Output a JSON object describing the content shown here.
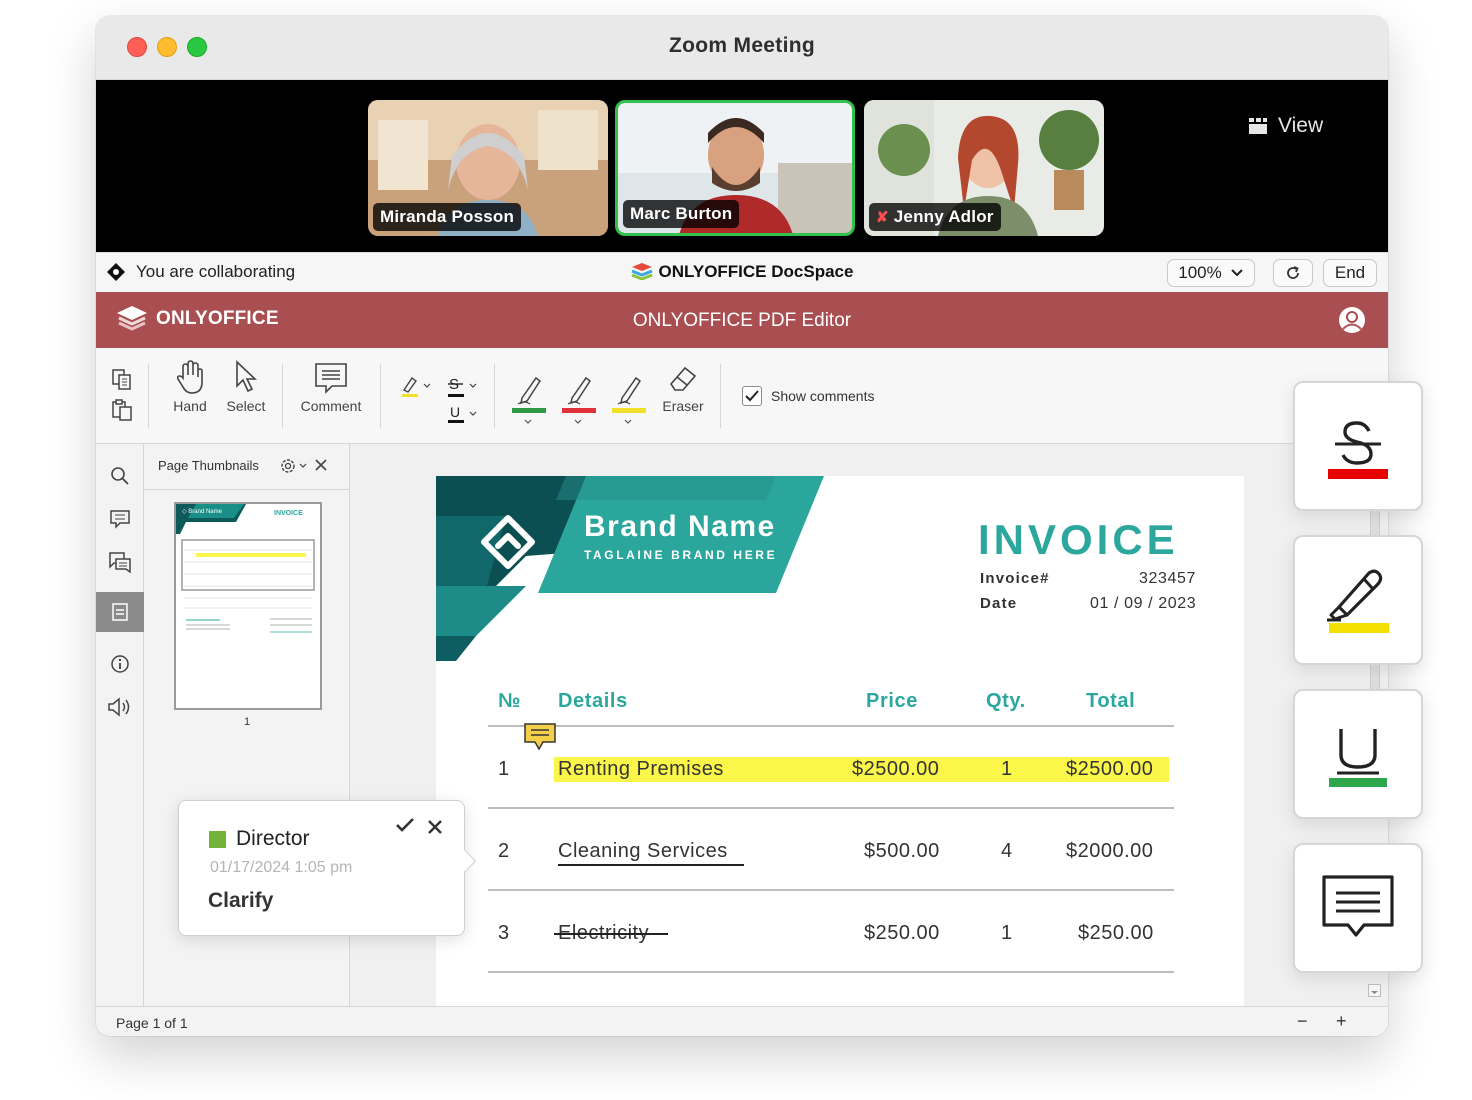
{
  "window": {
    "title": "Zoom Meeting"
  },
  "meeting": {
    "participants": [
      {
        "name": "Miranda Posson",
        "muted": false,
        "active": false
      },
      {
        "name": "Marc Burton",
        "muted": false,
        "active": true
      },
      {
        "name": "Jenny Adlor",
        "muted": true,
        "active": false
      }
    ],
    "view_label": "View"
  },
  "collab_bar": {
    "status": "You are collaborating",
    "app_name": "ONLYOFFICE DocSpace",
    "zoom": "100%",
    "end_label": "End"
  },
  "app_header": {
    "brand": "ONLYOFFICE",
    "title": "ONLYOFFICE PDF Editor",
    "color": "#a94f52"
  },
  "toolbar": {
    "hand": "Hand",
    "select": "Select",
    "comment": "Comment",
    "eraser": "Eraser",
    "show_comments": "Show comments",
    "show_comments_checked": true,
    "pen_colors": [
      "#2e9a45",
      "#e0303a",
      "#f2e12a"
    ]
  },
  "thumbnails": {
    "title": "Page Thumbnails",
    "page_number": "1"
  },
  "status_bar": {
    "page_info": "Page 1 of 1",
    "zoom_out": "−",
    "zoom_in": "+"
  },
  "invoice": {
    "brand_name": "Brand Name",
    "tagline": "TAGLAINE BRAND HERE",
    "heading": "INVOICE",
    "invoice_label": "Invoice#",
    "invoice_number": "323457",
    "date_label": "Date",
    "date": "01 / 09 / 2023",
    "columns": [
      "№",
      "Details",
      "Price",
      "Qty.",
      "Total"
    ],
    "rows": [
      {
        "no": "1",
        "details": "Renting Premises",
        "price": "$2500.00",
        "qty": "1",
        "total": "$2500.00",
        "markup": "highlight"
      },
      {
        "no": "2",
        "details": "Cleaning Services",
        "price": "$500.00",
        "qty": "4",
        "total": "$2000.00",
        "markup": "underline"
      },
      {
        "no": "3",
        "details": "Electricity",
        "price": "$250.00",
        "qty": "1",
        "total": "$250.00",
        "markup": "strikeout"
      }
    ],
    "accent": "#2ba79e",
    "highlight": "#fbf74a"
  },
  "comment": {
    "author": "Director",
    "date": "01/17/2024 1:05 pm",
    "text": "Clarify"
  },
  "annotation_cards": [
    {
      "icon": "strikeout-icon",
      "color": "#e60000"
    },
    {
      "icon": "highlight-pen-icon",
      "color": "#f2e000"
    },
    {
      "icon": "underline-icon",
      "color": "#2ea64b"
    },
    {
      "icon": "comment-icon",
      "color": ""
    }
  ],
  "icons": [
    "copy-icon",
    "paste-icon",
    "hand-icon",
    "cursor-icon",
    "comment-icon",
    "highlighter-icon",
    "strikeout-icon",
    "underline-icon",
    "pen-icon",
    "eraser-icon",
    "search-icon",
    "comments-panel-icon",
    "chat-icon",
    "thumbnails-icon",
    "info-icon",
    "speaker-icon",
    "settings-icon",
    "close-icon",
    "check-icon",
    "user-icon",
    "refresh-icon",
    "chevron-down-icon",
    "view-grid-icon",
    "onlyoffice-logo",
    "mic-muted-icon"
  ]
}
